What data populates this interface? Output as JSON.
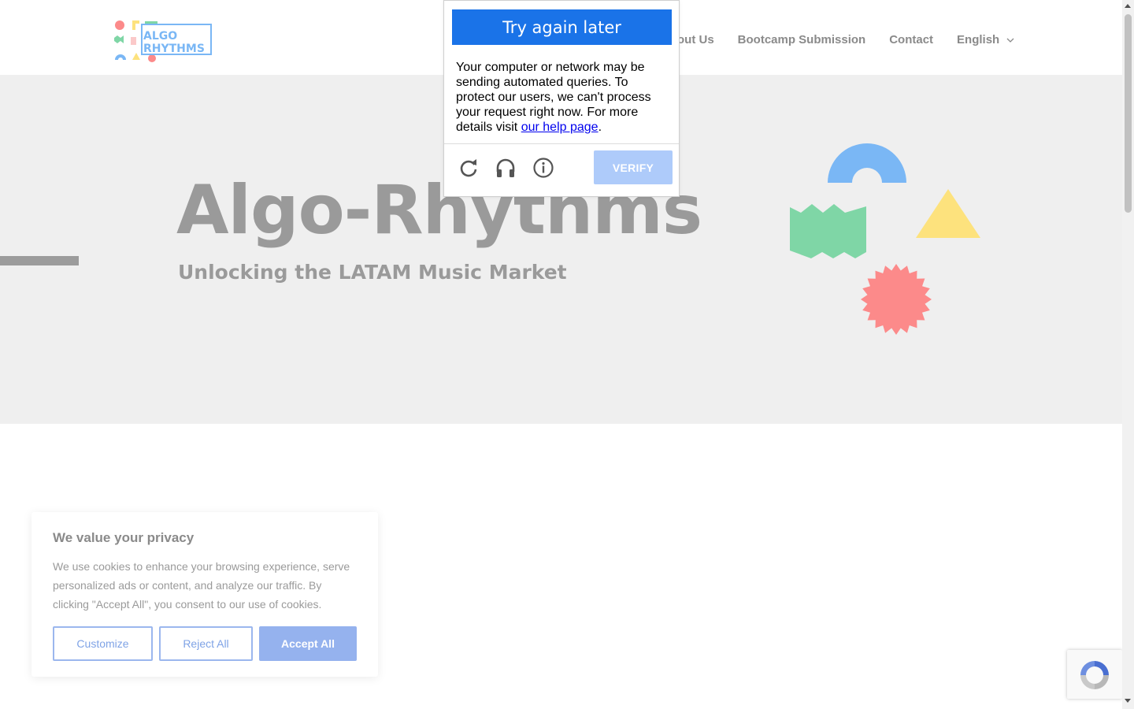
{
  "header": {
    "logo_line1": "ALGO",
    "logo_line2": "RHYTHMS",
    "nav": [
      {
        "label": "About Us"
      },
      {
        "label": "Bootcamp Submission"
      },
      {
        "label": "Contact"
      }
    ],
    "language": "English"
  },
  "hero": {
    "title": "Algo-Rhythms",
    "subtitle": "Unlocking the LATAM Music Market",
    "shape_colors": {
      "arc": "#7ab7f5",
      "wave": "#7fd6a6",
      "triangle": "#fde27d",
      "star": "#fc8a8a"
    }
  },
  "captcha": {
    "heading": "Try again later",
    "message": "Your computer or network may be sending automated queries. To protect our users, we can't process your request right now. For more details visit ",
    "link_text": "our help page",
    "message_end": ".",
    "icons": [
      "reload-icon",
      "headphones-icon",
      "info-icon"
    ],
    "verify_label": "VERIFY",
    "accent": "#1a73e8"
  },
  "cookie": {
    "title": "We value your privacy",
    "text": "We use cookies to enhance your browsing experience, serve personalized ads or content, and analyze our traffic. By clicking \"Accept All\", you consent to our use of cookies.",
    "buttons": {
      "customize": "Customize",
      "reject": "Reject All",
      "accept": "Accept All"
    }
  }
}
